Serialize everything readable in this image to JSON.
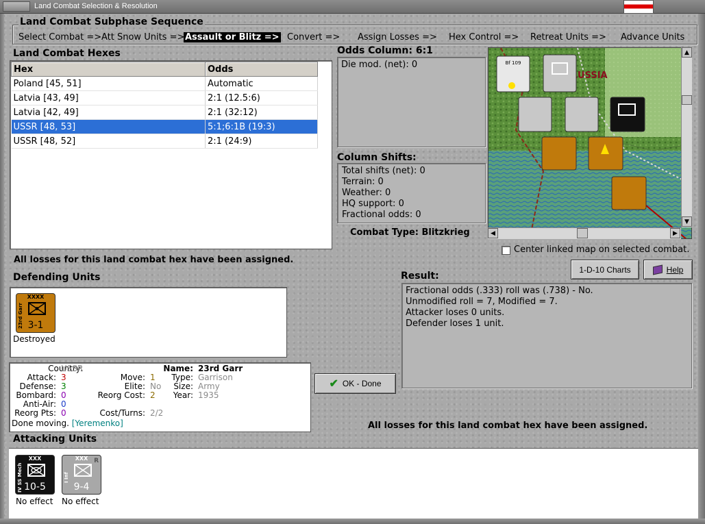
{
  "window": {
    "title": "Land Combat Selection & Resolution"
  },
  "sequence": {
    "title": "Land Combat Subphase Sequence",
    "steps": [
      "Select Combat =>",
      "Att Snow Units =>",
      "Assault or Blitz =>",
      "Convert =>",
      "Assign Losses =>",
      "Hex Control =>",
      "Retreat Units =>",
      "Advance Units"
    ],
    "active_index": 2
  },
  "hexes": {
    "title": "Land Combat Hexes",
    "columns": [
      "Hex",
      "Odds"
    ],
    "rows": [
      [
        "Poland [45, 51]",
        "Automatic"
      ],
      [
        "Latvia [43, 49]",
        "2:1 (12.5:6)"
      ],
      [
        "Latvia [42, 49]",
        "2:1 (32:12)"
      ],
      [
        "USSR [48, 53]",
        "5:1;6:1B (19:3)"
      ],
      [
        "USSR [48, 52]",
        "2:1 (24:9)"
      ]
    ],
    "selected_index": 3
  },
  "odds": {
    "title": "Odds Column: 6:1",
    "die_mod": "Die mod. (net): 0"
  },
  "shifts": {
    "title": "Column Shifts:",
    "lines": [
      "Total shifts (net): 0",
      "Terrain: 0",
      "Weather: 0",
      "HQ support: 0",
      "Fractional odds: 0"
    ]
  },
  "combat_type": "Combat Type:  Blitzkrieg",
  "map": {
    "label": "RUSSIA"
  },
  "center_linked": "Center linked map on selected combat.",
  "losses_msg": "All losses for this land combat hex have been assigned.",
  "buttons": {
    "charts": "1-D-10 Charts",
    "help": "Help",
    "ok": "OK - Done"
  },
  "defending": {
    "title": "Defending Units",
    "units": [
      {
        "side": "23rd Garr",
        "size": "XXXX",
        "strength": "3-1",
        "status": "Destroyed"
      }
    ]
  },
  "result": {
    "title": "Result:",
    "lines": [
      "Fractional odds (.333) roll was (.738)  - No.",
      "Unmodified roll = 7, Modified = 7.",
      "Attacker loses 0 units.",
      "Defender loses 1 unit."
    ]
  },
  "details": {
    "country_label": "Country:",
    "country": "USSR",
    "attack_label": "Attack:",
    "attack": "3",
    "defense_label": "Defense:",
    "defense": "3",
    "bombard_label": "Bombard:",
    "bombard": "0",
    "antiair_label": "Anti-Air:",
    "antiair": "0",
    "reorgpts_label": "Reorg Pts:",
    "reorgpts": "0",
    "done_moving": "Done moving.",
    "commander": "[Yeremenko]",
    "move_label": "Move:",
    "move": "1",
    "elite_label": "Elite:",
    "elite": "No",
    "reorgcost_label": "Reorg Cost:",
    "reorgcost": "2",
    "costturns_label": "Cost/Turns:",
    "costturns": "2/2",
    "name_label": "Name:",
    "name": "23rd Garr",
    "type_label": "Type:",
    "type": "Garrison",
    "size_label": "Size:",
    "size": "Army",
    "year_label": "Year:",
    "year": "1935"
  },
  "attacking": {
    "title": "Attacking Units",
    "units": [
      {
        "side": "IV SS Mech",
        "size": "XXX",
        "strength": "10-5",
        "status": "No effect"
      },
      {
        "side": "I Inf",
        "size": "XXX",
        "strength": "9-4",
        "status": "No effect",
        "r": "R"
      }
    ]
  },
  "colors": {
    "selected": "#2c6fd6",
    "soviet_counter": "#c07a0c",
    "ss_counter": "#111111",
    "german_counter": "#a8a8a8",
    "purple": "#8a00b0"
  }
}
